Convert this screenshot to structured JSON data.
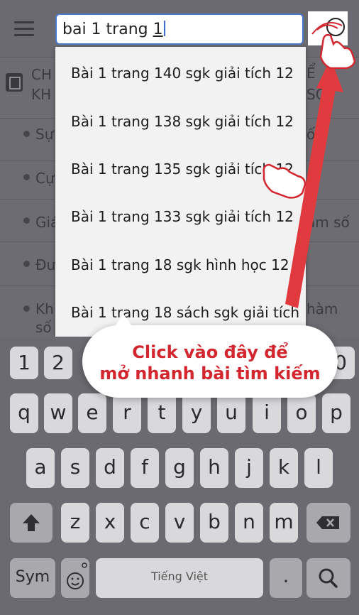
{
  "search": {
    "value_prefix": "bai 1 trang ",
    "value_last": "1"
  },
  "background": {
    "chapter_line1": "CH",
    "chapter_line2": "KH",
    "chapter_right1": "Ể",
    "chapter_right2": "SỐ",
    "rows": [
      {
        "left": "Sự",
        "right": "ố"
      },
      {
        "left": "Cự",
        "right": ""
      },
      {
        "left": "Giá",
        "right": "àm số"
      },
      {
        "left": "Đư",
        "right": ""
      },
      {
        "left": "Kh",
        "left2": "số",
        "right": "hàm"
      }
    ]
  },
  "suggestions": [
    "Bài 1 trang 140 sgk giải tích 12",
    "Bài 1 trang 138 sgk giải tích 12",
    "Bài 1 trang 135 sgk giải tích 12",
    "Bài 1 trang 133 sgk giải tích 12",
    "Bài 1 trang 18 sgk hình học 12",
    "Bài 1 trang 18 sách sgk giải tích"
  ],
  "keyboard": {
    "row_numbers": [
      "1",
      "2",
      "0"
    ],
    "row1": [
      "q",
      "w",
      "e",
      "r",
      "t",
      "y",
      "u",
      "i",
      "o",
      "p"
    ],
    "row2": [
      "a",
      "s",
      "d",
      "f",
      "g",
      "h",
      "j",
      "k",
      "l"
    ],
    "row3": [
      "z",
      "x",
      "c",
      "v",
      "b",
      "n",
      "m"
    ],
    "sym": "Sym",
    "space": "Tiếng Việt",
    "period": "."
  },
  "callout": {
    "line1": "Click vào đây để",
    "line2": "mở nhanh bài tìm kiếm"
  },
  "colors": {
    "accent_red": "#d3262f",
    "input_border": "#4a79c9"
  }
}
